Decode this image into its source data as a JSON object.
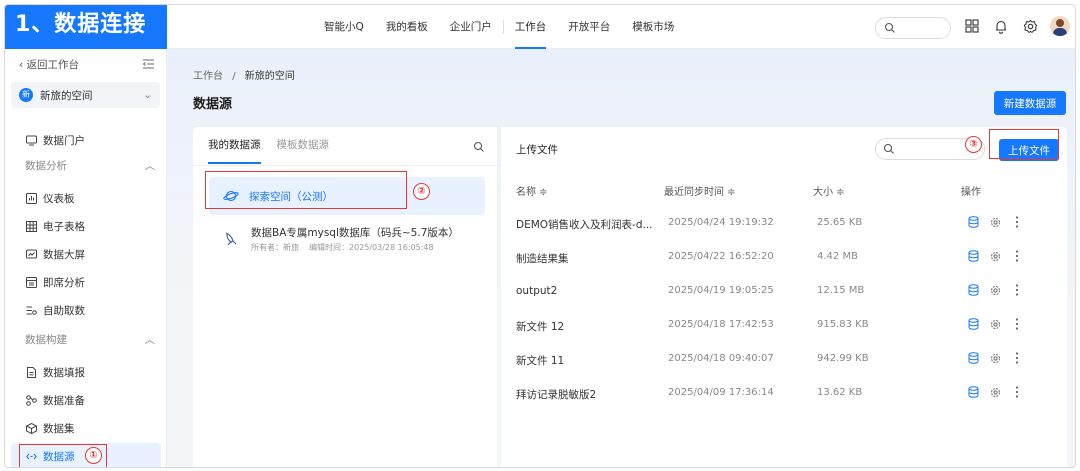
{
  "banner": "1、数据连接",
  "nav": {
    "items": [
      "智能小Q",
      "我的看板",
      "企业门户",
      "工作台",
      "开放平台",
      "模板市场"
    ],
    "active": "工作台"
  },
  "sidebar": {
    "back_label": "返回工作台",
    "space_icon_text": "新",
    "space_name": "新旅的空间",
    "items": [
      {
        "label": "数据门户",
        "icon": "portal-icon"
      },
      {
        "label": "仪表板",
        "icon": "dashboard-icon"
      },
      {
        "label": "电子表格",
        "icon": "spreadsheet-icon"
      },
      {
        "label": "数据大屏",
        "icon": "big-screen-icon"
      },
      {
        "label": "即席分析",
        "icon": "adhoc-analysis-icon"
      },
      {
        "label": "自助取数",
        "icon": "self-service-icon"
      },
      {
        "label": "数据填报",
        "icon": "data-fill-icon"
      },
      {
        "label": "数据准备",
        "icon": "data-prep-icon"
      },
      {
        "label": "数据集",
        "icon": "dataset-icon"
      },
      {
        "label": "数据源",
        "icon": "datasource-icon"
      }
    ],
    "groups": [
      "数据分析",
      "数据构建"
    ],
    "active": "数据源"
  },
  "breadcrumb": {
    "root": "工作台",
    "sep": "/",
    "current": "新旅的空间"
  },
  "page_title": "数据源",
  "new_datasource_button": "新建数据源",
  "left_panel": {
    "tabs": [
      "我的数据源",
      "模板数据源"
    ],
    "active_tab": "我的数据源",
    "sources": [
      {
        "name": "探索空间（公测）",
        "owner": "",
        "edited": ""
      },
      {
        "name": "数据BA专属mysql数据库（码兵~5.7版本）",
        "owner": "所有者：新旅",
        "edited": "编辑时间：2025/03/28 16:05:48"
      }
    ]
  },
  "right_panel": {
    "title": "上传文件",
    "upload_button": "上传文件",
    "columns": {
      "name": "名称 ≑",
      "time": "最近同步时间 ≑",
      "size": "大小 ≑",
      "ops": "操作"
    },
    "rows": [
      {
        "name": "DEMO销售收入及利润表-d...",
        "time": "2025/04/24 19:19:32",
        "size": "25.65 KB"
      },
      {
        "name": "制造结果集",
        "time": "2025/04/22 16:52:20",
        "size": "4.42 MB"
      },
      {
        "name": "output2",
        "time": "2025/04/19 19:05:25",
        "size": "12.15 MB"
      },
      {
        "name": "新文件 12",
        "time": "2025/04/18 17:42:53",
        "size": "915.83 KB"
      },
      {
        "name": "新文件 11",
        "time": "2025/04/18 09:40:07",
        "size": "942.99 KB"
      },
      {
        "name": "拜访记录脱敏版2",
        "time": "2025/04/09 17:36:14",
        "size": "13.62 KB"
      }
    ]
  },
  "annotations": {
    "one": "①",
    "two": "②",
    "three": "③"
  },
  "colors": {
    "accent": "#1677ff",
    "annotation": "#e53935",
    "active_bg": "#e8f1ff"
  }
}
